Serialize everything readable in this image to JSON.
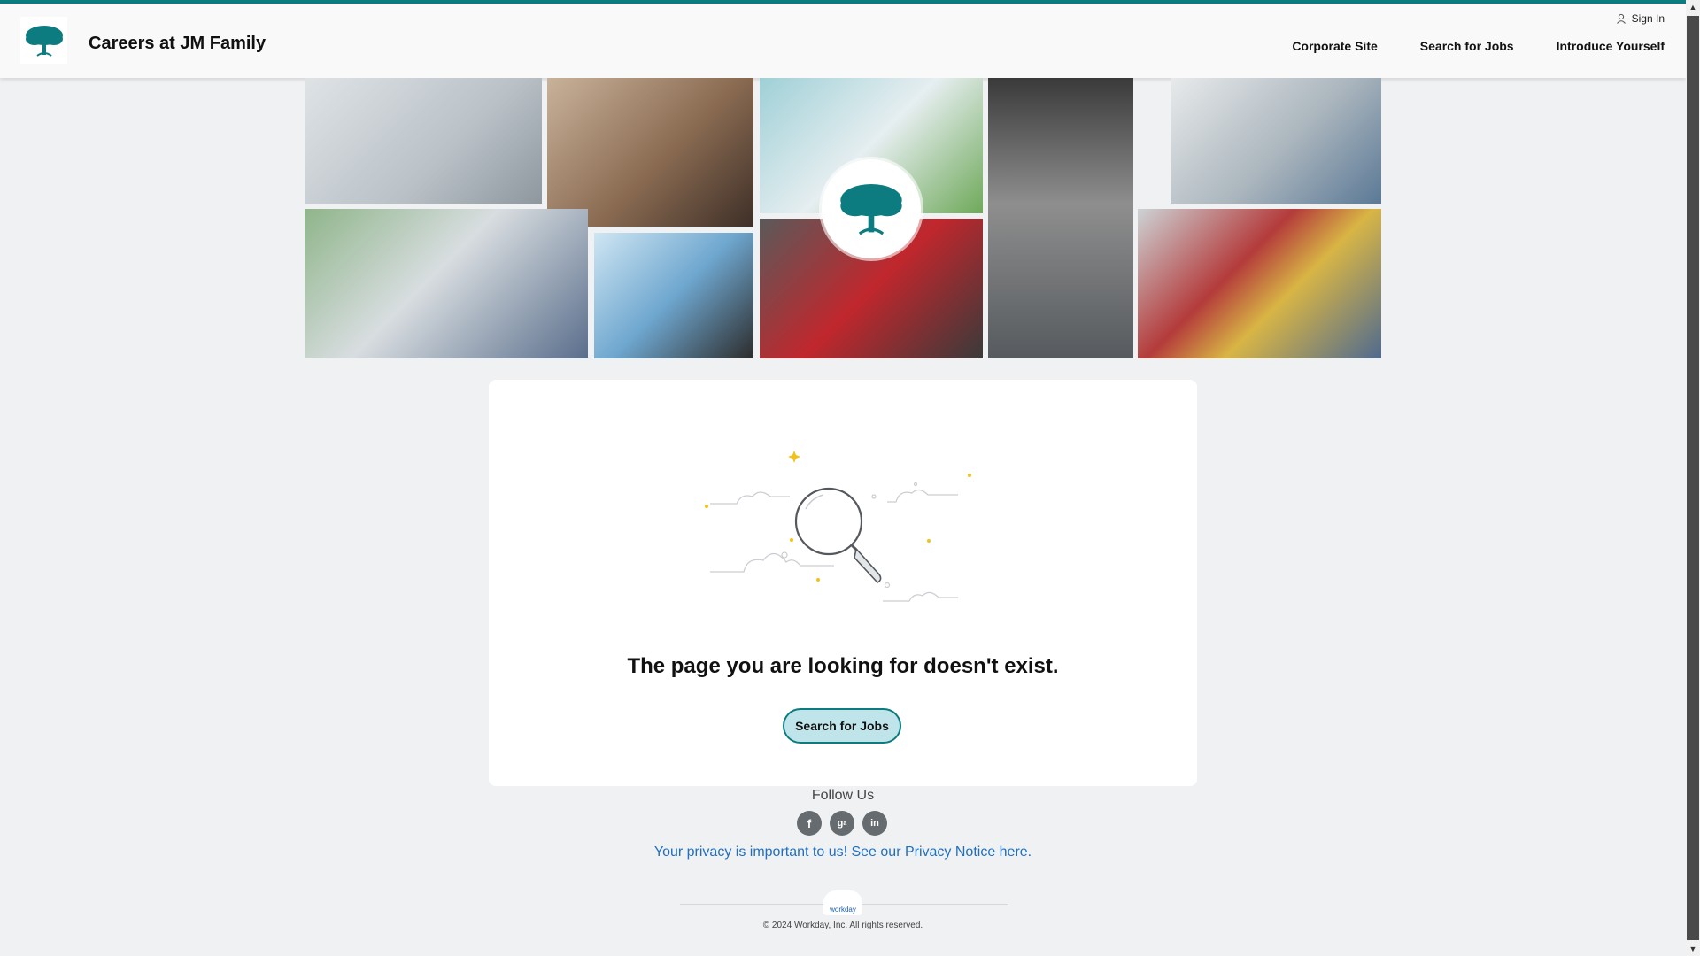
{
  "header": {
    "title": "Careers at JM Family",
    "sign_in": "Sign In",
    "nav": [
      "Corporate Site",
      "Search for Jobs",
      "Introduce Yourself"
    ]
  },
  "main": {
    "error_title": "The page you are looking for doesn't exist.",
    "search_button": "Search for Jobs"
  },
  "footer": {
    "follow_us": "Follow Us",
    "social": [
      "facebook-icon",
      "glassdoor-icon",
      "linkedin-icon"
    ],
    "privacy_link": "Your privacy is important to us! See our Privacy Notice here.",
    "powered_logo": "workday",
    "copyright": "© 2024 Workday, Inc. All rights reserved."
  },
  "colors": {
    "accent": "#0d7c80",
    "button_bg": "#bfe5ea",
    "link": "#1f6fbf",
    "page_bg": "#f0f1f3"
  }
}
